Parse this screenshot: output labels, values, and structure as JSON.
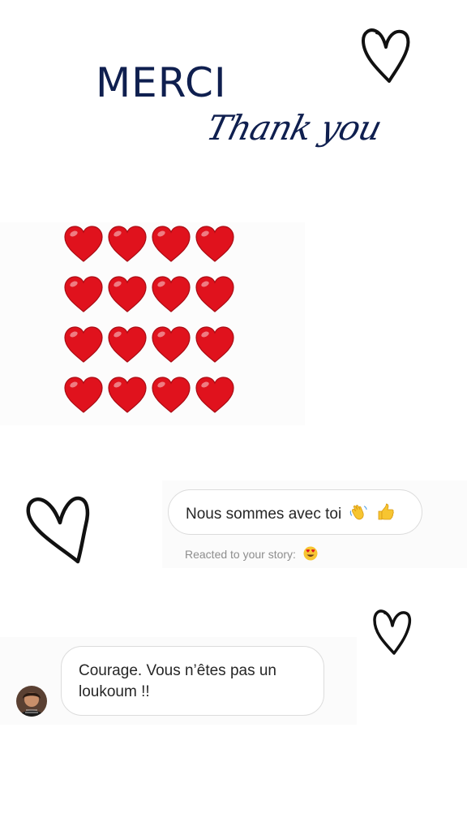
{
  "header": {
    "title": "MERCI",
    "subtitle": "Thank you"
  },
  "colors": {
    "navy": "#0f1f4f",
    "heart_red": "#e0121d",
    "bubble_border": "#dcdcdc",
    "meta_text": "#8e8e8e"
  },
  "heart_grid": {
    "icon": "red-heart-icon",
    "rows": 4,
    "columns": 4
  },
  "messages": [
    {
      "text": "Nous sommes avec toi",
      "emojis": [
        "waving-hand-icon",
        "thumbs-up-icon"
      ],
      "reaction_note": "Reacted to your story:",
      "reaction_emoji": "heart-eyes-face-icon"
    },
    {
      "text": "Courage. Vous n’êtes pas un loukoum !!",
      "sender_avatar": "avatar"
    }
  ],
  "decorations": [
    "hand-drawn-heart-icon",
    "hand-drawn-heart-icon",
    "hand-drawn-heart-icon"
  ]
}
